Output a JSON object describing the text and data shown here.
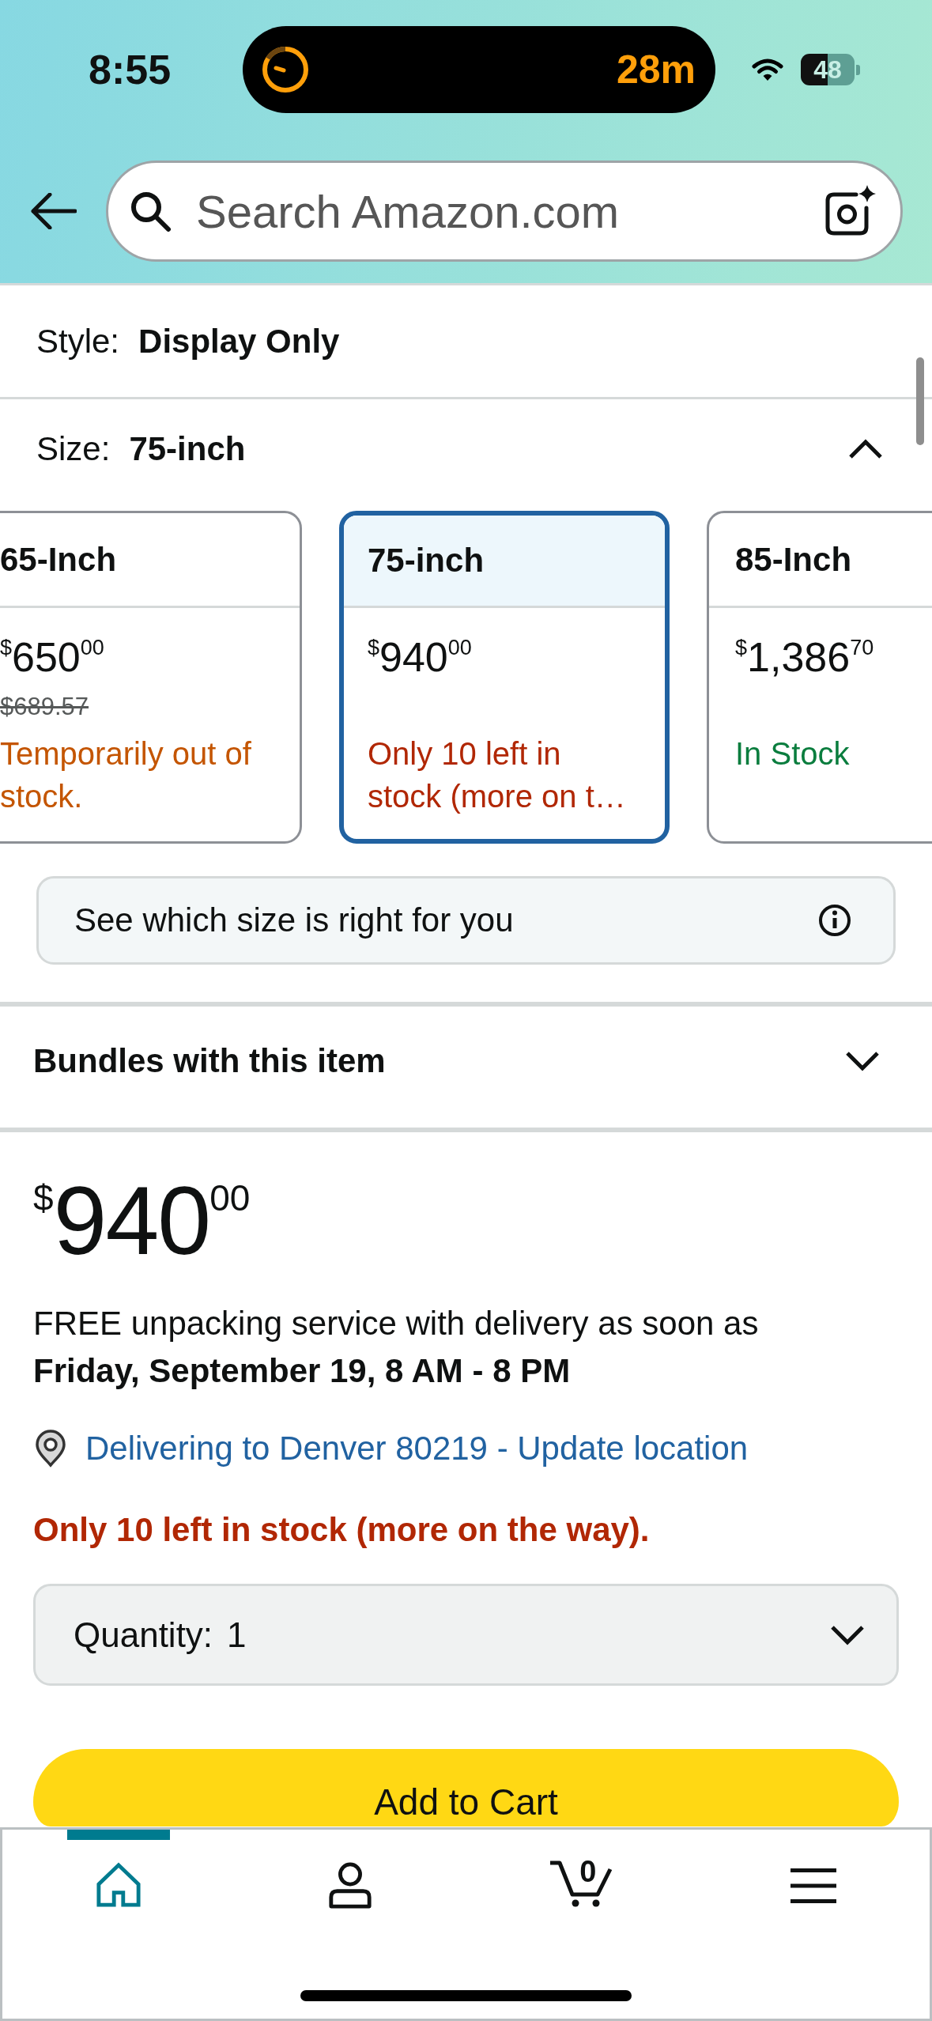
{
  "status_bar": {
    "time": "8:55",
    "activity_timer": "28m",
    "battery": "48"
  },
  "search": {
    "placeholder": "Search Amazon.com"
  },
  "style_option": {
    "label": "Style:",
    "value": "Display Only"
  },
  "size_option": {
    "label": "Size:",
    "value": "75-inch",
    "expanded": true
  },
  "size_cards": [
    {
      "name": "65-Inch",
      "price": {
        "currency": "$",
        "whole": "650",
        "fraction": "00"
      },
      "list_price": "$689.57",
      "availability": "Temporarily out of stock.",
      "kind": "unavailable",
      "selected": false
    },
    {
      "name": "75-inch",
      "price": {
        "currency": "$",
        "whole": "940",
        "fraction": "00"
      },
      "availability": "Only 10 left in stock (more on t…",
      "kind": "limited",
      "selected": true
    },
    {
      "name": "85-Inch",
      "price": {
        "currency": "$",
        "whole": "1,386",
        "fraction": "70"
      },
      "availability": "In Stock",
      "kind": "available",
      "selected": false
    }
  ],
  "size_guide": {
    "text": "See which size is right for you"
  },
  "bundles": {
    "title": "Bundles with this item",
    "expanded": false
  },
  "buy_box": {
    "price": {
      "currency": "$",
      "whole": "940",
      "fraction": "00"
    },
    "delivery": "FREE unpacking service with delivery as soon as **Friday, September 19, 8 AM - 8 PM**",
    "location_link": "Delivering to Denver 80219 - Update location",
    "stock_message": "Only 10 left in stock (more on the way).",
    "quantity": {
      "label": "Quantity:",
      "value": "1"
    },
    "add_to_cart": "Add to Cart"
  },
  "tab_bar": [
    {
      "kind": "home",
      "selected": true
    },
    {
      "kind": "account",
      "selected": false
    },
    {
      "kind": "cart",
      "selected": false,
      "count": "0"
    },
    {
      "kind": "menu",
      "selected": false
    }
  ]
}
